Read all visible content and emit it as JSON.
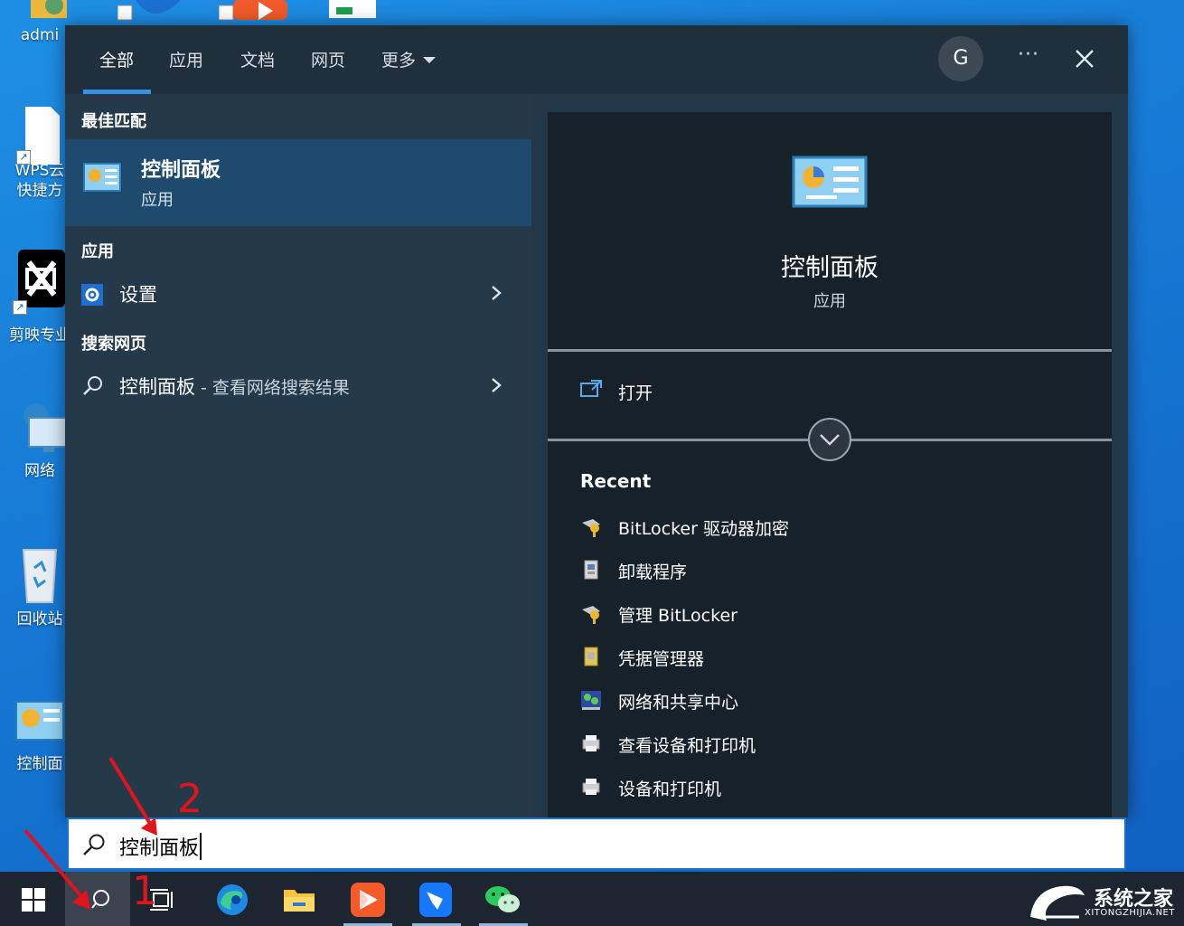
{
  "desktop": {
    "icons": [
      {
        "label": "admi",
        "top": 0
      },
      {
        "label": "WPS云",
        "label2": "快捷方"
      },
      {
        "label": "剪映专业"
      },
      {
        "label": "网络"
      },
      {
        "label": "回收站"
      },
      {
        "label": "控制面"
      }
    ]
  },
  "search_window": {
    "tabs": [
      "全部",
      "应用",
      "文档",
      "网页",
      "更多"
    ],
    "avatar_letter": "G",
    "more_glyph": "···",
    "best_match_heading": "最佳匹配",
    "best_match": {
      "title": "控制面板",
      "subtitle": "应用"
    },
    "apps_heading": "应用",
    "apps": [
      {
        "label": "设置"
      }
    ],
    "web_heading": "搜索网页",
    "web_result": {
      "query": "控制面板",
      "suffix": " - 查看网络搜索结果"
    },
    "preview": {
      "title": "控制面板",
      "subtitle": "应用",
      "open_label": "打开",
      "recent_heading": "Recent"
    },
    "recent": [
      {
        "label": "BitLocker 驱动器加密",
        "icon": "bitlocker-key-icon"
      },
      {
        "label": "卸载程序",
        "icon": "uninstall-program-icon"
      },
      {
        "label": "管理 BitLocker",
        "icon": "bitlocker-key-icon"
      },
      {
        "label": "凭据管理器",
        "icon": "credential-manager-icon"
      },
      {
        "label": "网络和共享中心",
        "icon": "network-center-icon"
      },
      {
        "label": "查看设备和打印机",
        "icon": "printer-icon"
      },
      {
        "label": "设备和打印机",
        "icon": "printer-icon"
      }
    ]
  },
  "search_box": {
    "value": "控制面板"
  },
  "annotations": {
    "step1": "1",
    "step2": "2"
  },
  "watermark": {
    "title": "系统之家",
    "subtitle": "XITONGZHIJIA.NET"
  },
  "colors": {
    "accent": "#3a8fe0",
    "window_bg": "#233746",
    "selected_bg": "#1e4a6e",
    "preview_bg": "#16212a",
    "annotation_red": "#e0141c"
  }
}
